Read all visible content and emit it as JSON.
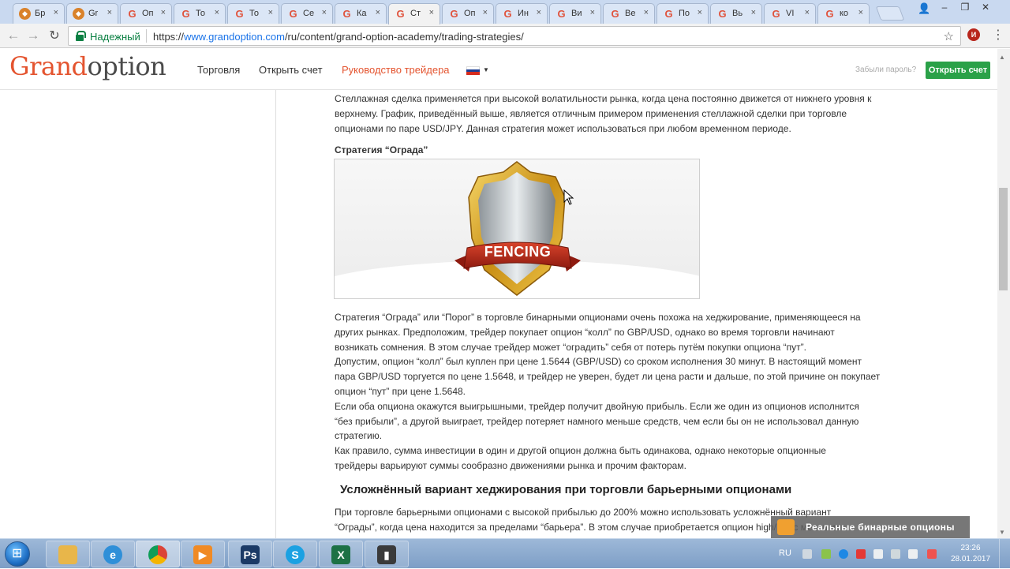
{
  "browser": {
    "tabs": [
      {
        "label": "Бр",
        "favicon": "fox"
      },
      {
        "label": "Gr",
        "favicon": "fox"
      },
      {
        "label": "Оп",
        "favicon": "G"
      },
      {
        "label": "То",
        "favicon": "G"
      },
      {
        "label": "То",
        "favicon": "G"
      },
      {
        "label": "Се",
        "favicon": "G"
      },
      {
        "label": "Ка",
        "favicon": "G"
      },
      {
        "label": "Ст",
        "favicon": "G",
        "active": true
      },
      {
        "label": "Оп",
        "favicon": "G"
      },
      {
        "label": "Ин",
        "favicon": "G"
      },
      {
        "label": "Ви",
        "favicon": "G"
      },
      {
        "label": "Ве",
        "favicon": "G"
      },
      {
        "label": "По",
        "favicon": "G"
      },
      {
        "label": "Вь",
        "favicon": "G"
      },
      {
        "label": "VI",
        "favicon": "G"
      },
      {
        "label": "ко",
        "favicon": "G"
      }
    ],
    "secure_label": "Надежный",
    "url_scheme": "https://",
    "url_host": "www.grandoption.com",
    "url_path": "/ru/content/grand-option-academy/trading-strategies/",
    "ext_badge": "И"
  },
  "site": {
    "logo_grand": "Grand",
    "logo_option": "option",
    "nav": [
      "Торговля",
      "Открыть счет",
      "Руководство трейдера"
    ],
    "forgot_password": "Забыли пароль?",
    "open_account": "Открыть счет"
  },
  "article": {
    "para1": [
      "Стеллажная сделка применяется при высокой волатильности рынка, когда цена постоянно движется от нижнего уровня к",
      "верхнему. График, приведённый выше, является отличным примером применения стеллажной сделки при торговле",
      "опционами по паре USD/JPY. Данная стратегия может использоваться при любом временном периоде."
    ],
    "strategy_title": "Стратегия “Ограда”",
    "image_caption": "FENCING",
    "para2": [
      "Стратегия “Ограда” или “Порог” в торговле бинарными опционами очень похожа на хеджирование, применяющееся на",
      "других рынках. Предположим, трейдер покупает опцион “колл” по GBP/USD, однако во время торговли начинают",
      "возникать сомнения. В этом случае трейдер может “оградить” себя от потерь путём покупки опциона “пут”.",
      "Допустим, опцион “колл” был куплен при цене 1.5644 (GBP/USD) со сроком исполнения 30 минут. В настоящий момент",
      "пара GBP/USD торгуется по цене 1.5648, и трейдер не уверен, будет ли цена расти и дальше, по этой причине он покупает",
      "опцион “пут” при цене 1.5648.",
      "Если оба опциона окажутся выигрышными, трейдер получит двойную прибыль. Если же один из опционов исполнится",
      "“без прибыли”, а другой выиграет, трейдер потеряет намного меньше средств, чем если бы он не использовал данную",
      "стратегию.",
      "Как правило, сумма инвестиции в один и другой опцион должна быть одинакова, однако некоторые опционные",
      "трейдеры варьируют суммы сообразно движениями рынка и прочим факторам."
    ],
    "heading": "Усложнённый вариант хеджирования при торговли барьерными опционами",
    "para3": [
      "При торговле барьерными опционами с высокой прибылью до 200% можно использовать  усложнённый вариант",
      "“Ограды”, когда цена находится за пределами “барьера”. В этом случае приобретается опцион high/low с меньшим"
    ]
  },
  "overlay": {
    "text": "Реальные бинарные опционы"
  },
  "taskbar": {
    "language": "RU",
    "time": "23:26",
    "date": "28.01.2017"
  }
}
